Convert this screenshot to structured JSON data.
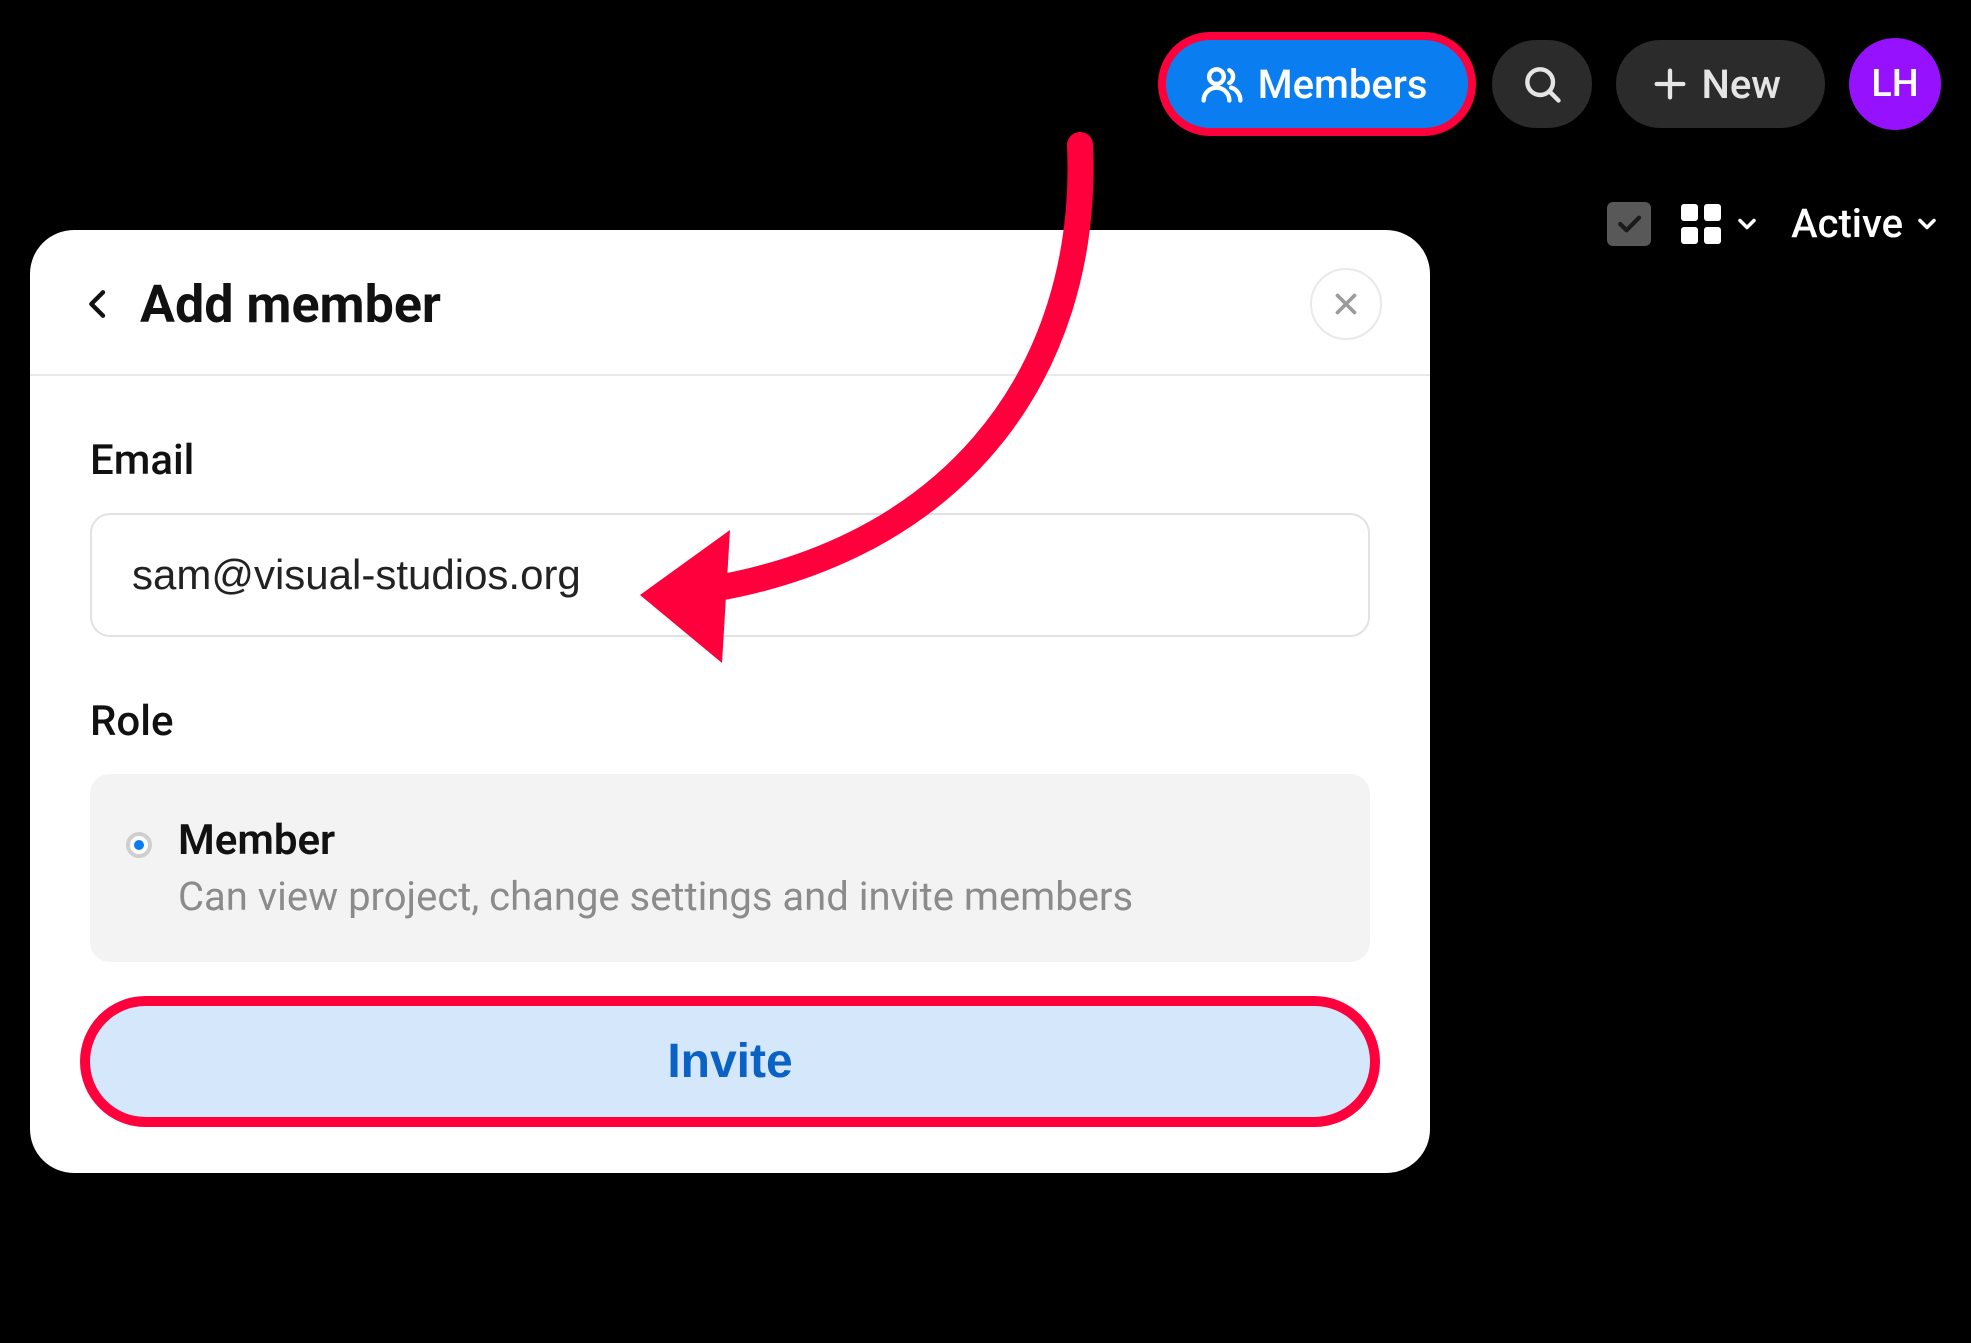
{
  "topbar": {
    "members_label": "Members",
    "new_label": "New",
    "avatar_initials": "LH"
  },
  "filterbar": {
    "status_label": "Active"
  },
  "modal": {
    "title": "Add member",
    "email_label": "Email",
    "email_value": "sam@visual-studios.org",
    "role_label": "Role",
    "role_option": {
      "name": "Member",
      "desc": "Can view project, change settings and invite members"
    },
    "invite_label": "Invite"
  },
  "annotation": {
    "highlight_color": "#ff003d",
    "members_pill_color": "#0a7df0",
    "avatar_color": "#9612ff"
  }
}
